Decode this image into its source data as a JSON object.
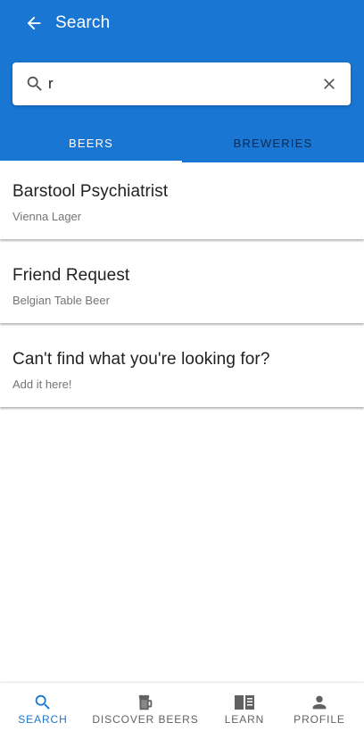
{
  "app_bar": {
    "title": "Search",
    "back_icon": "arrow-back-icon"
  },
  "search": {
    "value": "r",
    "placeholder": "",
    "search_icon": "search-icon",
    "clear_icon": "close-icon"
  },
  "tabs": [
    {
      "label": "BEERS",
      "active": true
    },
    {
      "label": "BREWERIES",
      "active": false
    }
  ],
  "results": [
    {
      "title": "Barstool Psychiatrist",
      "subtitle": "Vienna Lager"
    },
    {
      "title": "Friend Request",
      "subtitle": "Belgian Table Beer"
    },
    {
      "title": "Can't find what you're looking for?",
      "subtitle": "Add it here!"
    }
  ],
  "bottom_nav": [
    {
      "label": "SEARCH",
      "icon": "search-icon",
      "active": true
    },
    {
      "label": "DISCOVER BEERS",
      "icon": "beer-mug-icon",
      "active": false
    },
    {
      "label": "LEARN",
      "icon": "book-icon",
      "active": false
    },
    {
      "label": "PROFILE",
      "icon": "person-icon",
      "active": false
    }
  ],
  "colors": {
    "primary": "#1976d2",
    "inactive_tab": "#0d2b52",
    "nav_inactive": "#616161",
    "subtitle": "#757575"
  }
}
